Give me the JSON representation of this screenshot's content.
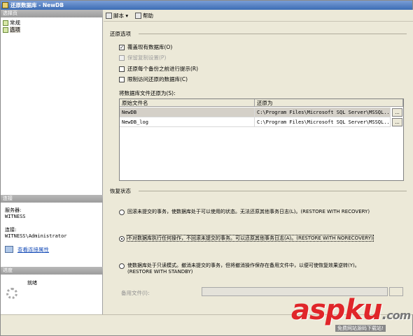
{
  "window": {
    "title": "还原数据库 - NewDB"
  },
  "left": {
    "select_page_header": "选择页",
    "pages": [
      {
        "label": "常规"
      },
      {
        "label": "选项"
      }
    ],
    "connection_header": "连接",
    "server_label": "服务器:",
    "server_value": "WITNESS",
    "connection_label": "连接:",
    "connection_value": "WITNESS\\Administrator",
    "view_properties_link": "查看连接属性",
    "progress_header": "进度",
    "status": "就绪"
  },
  "toolbar": {
    "script": "脚本",
    "help": "帮助"
  },
  "restore_options": {
    "title": "还原选项",
    "checkboxes": [
      {
        "label": "覆盖现有数据库(O)",
        "checked": "✓"
      },
      {
        "label": "保留复制设置(P)",
        "checked": ""
      },
      {
        "label": "还原每个备份之前进行提示(R)",
        "checked": ""
      },
      {
        "label": "限制访问还原的数据库(C)",
        "checked": ""
      }
    ],
    "files_label": "将数据库文件还原为(S):",
    "grid": {
      "headers": [
        "原始文件名",
        "还原为"
      ],
      "rows": [
        {
          "original": "NewDB",
          "restore_as": "C:\\Program Files\\Microsoft SQL Server\\MSSQL..."
        },
        {
          "original": "NewDB_log",
          "restore_as": "C:\\Program Files\\Microsoft SQL Server\\MSSQL..."
        }
      ],
      "ellipsis": "..."
    }
  },
  "recovery_state": {
    "title": "恢复状态",
    "options": [
      {
        "text": "回滚未提交的事务，使数据库处于可以使用的状态。无法还原其他事务日志(L)。(RESTORE WITH RECOVERY)"
      },
      {
        "text": "不对数据库执行任何操作，不回滚未提交的事务。可以还原其他事务日志(A)。(RESTORE WITH NORECOVERY)"
      },
      {
        "text_line1": "使数据库处于只读模式。撤消未提交的事务，但将撤消操作保存在备用文件中，以便可使恢复效果逆转(Y)。",
        "text_line2": "(RESTORE WITH STANDBY)"
      }
    ],
    "selected_index": 1,
    "standby_file_label": "备用文件(I):"
  },
  "watermark": {
    "brand_asp": "asp",
    "brand_ku": "ku",
    "brand_dot": ".",
    "brand_com": "com",
    "slogan": "免费网站源码下载站!"
  },
  "colors": {
    "title_bar": "#3c6cb4",
    "link": "#1a4fb8",
    "watermark_red": "#e0262a"
  }
}
